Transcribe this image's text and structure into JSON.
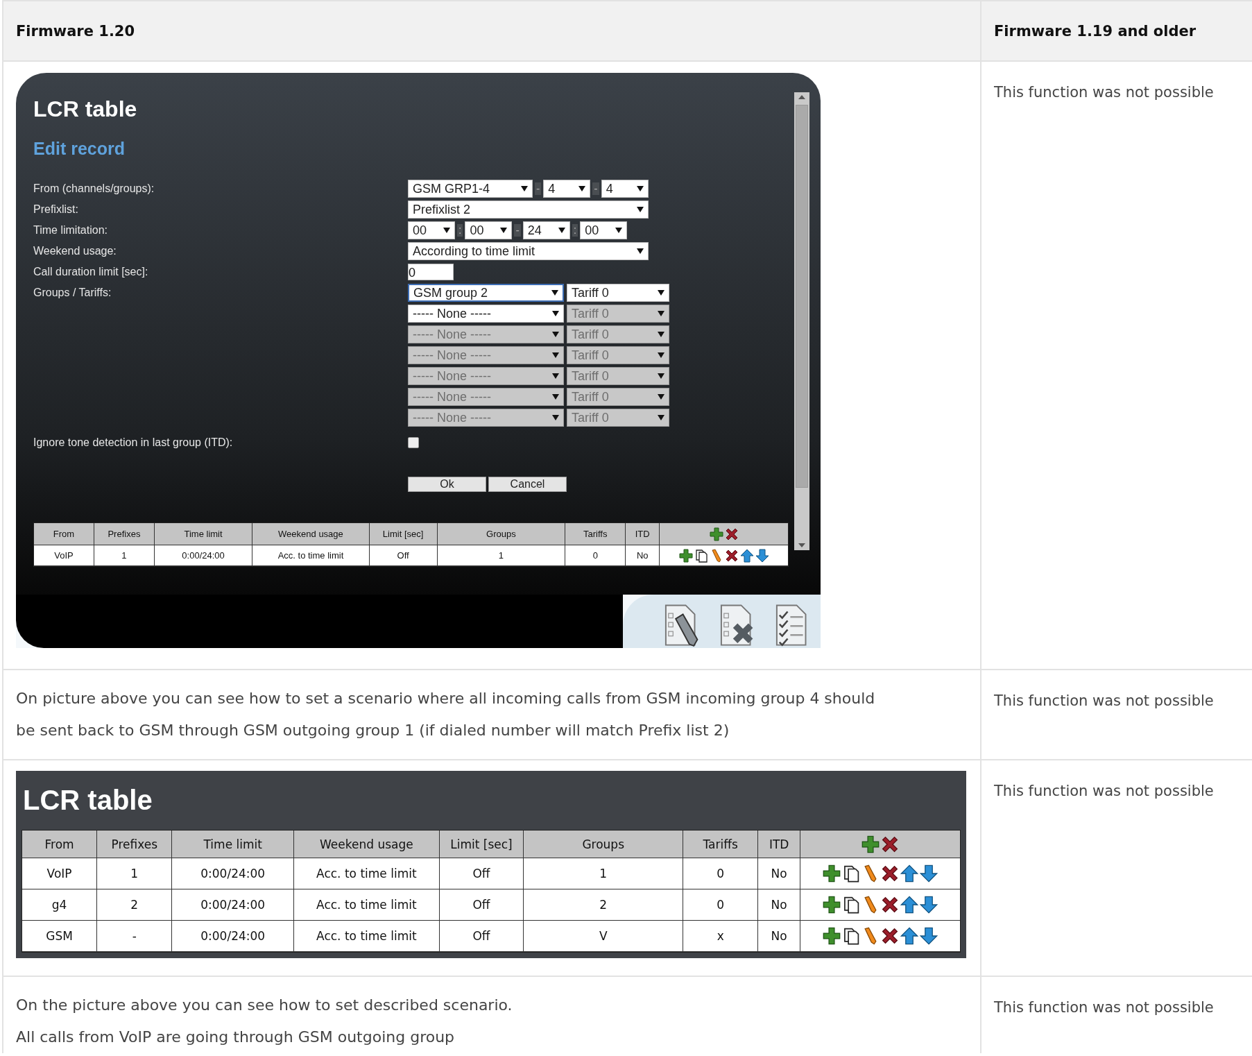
{
  "columns": [
    {
      "heading": "Firmware 1.20"
    },
    {
      "heading": "Firmware 1.19 and older"
    }
  ],
  "rows": [
    {
      "kind": "dialog",
      "old": "This function was not possible",
      "dialog": {
        "title": "LCR table",
        "subtitle": "Edit record",
        "fields": [
          {
            "label": "From (channels/groups):",
            "controls": [
              {
                "kind": "select",
                "value": "GSM GRP1-4"
              },
              {
                "kind": "separator",
                "text": "-"
              },
              {
                "kind": "select",
                "value": "4"
              },
              {
                "kind": "separator",
                "text": "-"
              },
              {
                "kind": "select",
                "value": "4"
              }
            ]
          },
          {
            "label": "Prefixlist:",
            "controls": [
              {
                "kind": "select",
                "value": "Prefixlist 2"
              }
            ]
          },
          {
            "label": "Time limitation:",
            "controls": [
              {
                "kind": "select",
                "value": "00"
              },
              {
                "kind": "separator",
                "text": ":"
              },
              {
                "kind": "select",
                "value": "00"
              },
              {
                "kind": "separator",
                "text": "-"
              },
              {
                "kind": "select",
                "value": "24"
              },
              {
                "kind": "separator",
                "text": ":"
              },
              {
                "kind": "select",
                "value": "00"
              }
            ]
          },
          {
            "label": "Weekend usage:",
            "controls": [
              {
                "kind": "select",
                "value": "According to time limit"
              }
            ]
          },
          {
            "label": "Call duration limit [sec]:",
            "controls": [
              {
                "kind": "input",
                "value": "0"
              }
            ]
          }
        ],
        "groups_label": "Groups / Tariffs:",
        "groups": [
          {
            "group": "GSM group 2",
            "group_disabled": false,
            "focused": true,
            "tariff": "Tariff 0",
            "tariff_disabled": false
          },
          {
            "group": "----- None -----",
            "group_disabled": false,
            "focused": false,
            "tariff": "Tariff 0",
            "tariff_disabled": true
          },
          {
            "group": "----- None -----",
            "group_disabled": true,
            "focused": false,
            "tariff": "Tariff 0",
            "tariff_disabled": true
          },
          {
            "group": "----- None -----",
            "group_disabled": true,
            "focused": false,
            "tariff": "Tariff 0",
            "tariff_disabled": true
          },
          {
            "group": "----- None -----",
            "group_disabled": true,
            "focused": false,
            "tariff": "Tariff 0",
            "tariff_disabled": true
          },
          {
            "group": "----- None -----",
            "group_disabled": true,
            "focused": false,
            "tariff": "Tariff 0",
            "tariff_disabled": true
          },
          {
            "group": "----- None -----",
            "group_disabled": true,
            "focused": false,
            "tariff": "Tariff 0",
            "tariff_disabled": true
          }
        ],
        "itd": {
          "label": "Ignore tone detection in last group (ITD):",
          "checked": false
        },
        "buttons": [
          "Ok",
          "Cancel"
        ],
        "table": {
          "columns": [
            "From",
            "Prefixes",
            "Time limit",
            "Weekend usage",
            "Limit [sec]",
            "Groups",
            "Tariffs",
            "ITD"
          ],
          "rows": [
            [
              "VoIP",
              "1",
              "0:00/24:00",
              "Acc. to time limit",
              "Off",
              "1",
              "0",
              "No"
            ]
          ]
        }
      }
    },
    {
      "kind": "text",
      "paragraphs": [
        "On picture above you can see how to set a scenario where all incoming calls from GSM incoming group 4 should be sent back to GSM through GSM outgoing group 1 (if dialed number will match Prefix list 2)"
      ],
      "old": "This function was not possible"
    },
    {
      "kind": "table",
      "table": {
        "title": "LCR table",
        "columns": [
          "From",
          "Prefixes",
          "Time limit",
          "Weekend usage",
          "Limit [sec]",
          "Groups",
          "Tariffs",
          "ITD"
        ],
        "rows": [
          [
            "VoIP",
            "1",
            "0:00/24:00",
            "Acc. to time limit",
            "Off",
            "1",
            "0",
            "No"
          ],
          [
            "g4",
            "2",
            "0:00/24:00",
            "Acc. to time limit",
            "Off",
            "2",
            "0",
            "No"
          ],
          [
            "GSM",
            "-",
            "0:00/24:00",
            "Acc. to time limit",
            "Off",
            "V",
            "x",
            "No"
          ]
        ]
      },
      "old": "This function was not possible"
    },
    {
      "kind": "text",
      "paragraphs": [
        "On the picture above you can see how to set described scenario.",
        "All calls from VoIP are going through GSM outgoing group"
      ],
      "old": "This function was not possible"
    }
  ]
}
